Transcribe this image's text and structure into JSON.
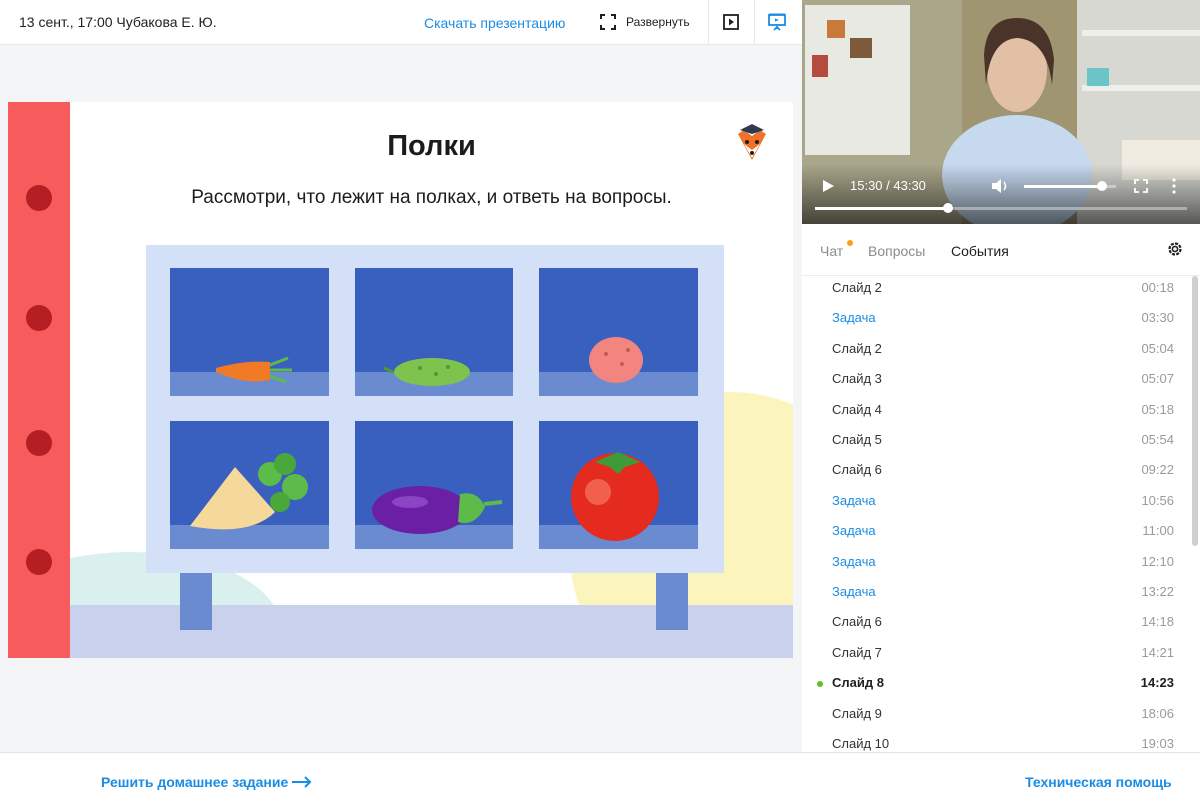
{
  "header": {
    "lesson_title": "13 сент., 17:00 Чубакова Е. Ю.",
    "download_label": "Скачать презентацию",
    "expand_label": "Развернуть"
  },
  "slide": {
    "title": "Полки",
    "subtitle": "Рассмотри, что лежит на полках, и ответь на вопросы.",
    "shelf_items": [
      "carrot",
      "cucumber",
      "potato",
      "parsnip",
      "eggplant",
      "tomato"
    ]
  },
  "video": {
    "time": "15:30 / 43:30",
    "progress": 0.3563,
    "volume": 0.85
  },
  "panel": {
    "tabs": [
      {
        "label": "Чат",
        "active": false,
        "has_new": true
      },
      {
        "label": "Вопросы",
        "active": false
      },
      {
        "label": "События",
        "active": true
      }
    ],
    "events": [
      {
        "name": "Слайд 2",
        "time": "00:18",
        "type": "slide"
      },
      {
        "name": "Задача",
        "time": "03:30",
        "type": "task"
      },
      {
        "name": "Слайд 2",
        "time": "05:04",
        "type": "slide"
      },
      {
        "name": "Слайд 3",
        "time": "05:07",
        "type": "slide"
      },
      {
        "name": "Слайд 4",
        "time": "05:18",
        "type": "slide"
      },
      {
        "name": "Слайд 5",
        "time": "05:54",
        "type": "slide"
      },
      {
        "name": "Слайд 6",
        "time": "09:22",
        "type": "slide"
      },
      {
        "name": "Задача",
        "time": "10:56",
        "type": "task"
      },
      {
        "name": "Задача",
        "time": "11:00",
        "type": "task"
      },
      {
        "name": "Задача",
        "time": "12:10",
        "type": "task"
      },
      {
        "name": "Задача",
        "time": "13:22",
        "type": "task"
      },
      {
        "name": "Слайд 6",
        "time": "14:18",
        "type": "slide"
      },
      {
        "name": "Слайд 7",
        "time": "14:21",
        "type": "slide"
      },
      {
        "name": "Слайд 8",
        "time": "14:23",
        "type": "slide",
        "current": true
      },
      {
        "name": "Слайд 9",
        "time": "18:06",
        "type": "slide"
      },
      {
        "name": "Слайд 10",
        "time": "19:03",
        "type": "slide"
      }
    ]
  },
  "footer": {
    "homework_label": "Решить домашнее задание",
    "help_label": "Техническая помощь"
  },
  "colors": {
    "accent": "#1a8ce3",
    "binder": "#f85b5b",
    "shelf_frame": "#d3e0f7",
    "shelf_bg": "#395fbf",
    "current_dot": "#62bf2c"
  }
}
